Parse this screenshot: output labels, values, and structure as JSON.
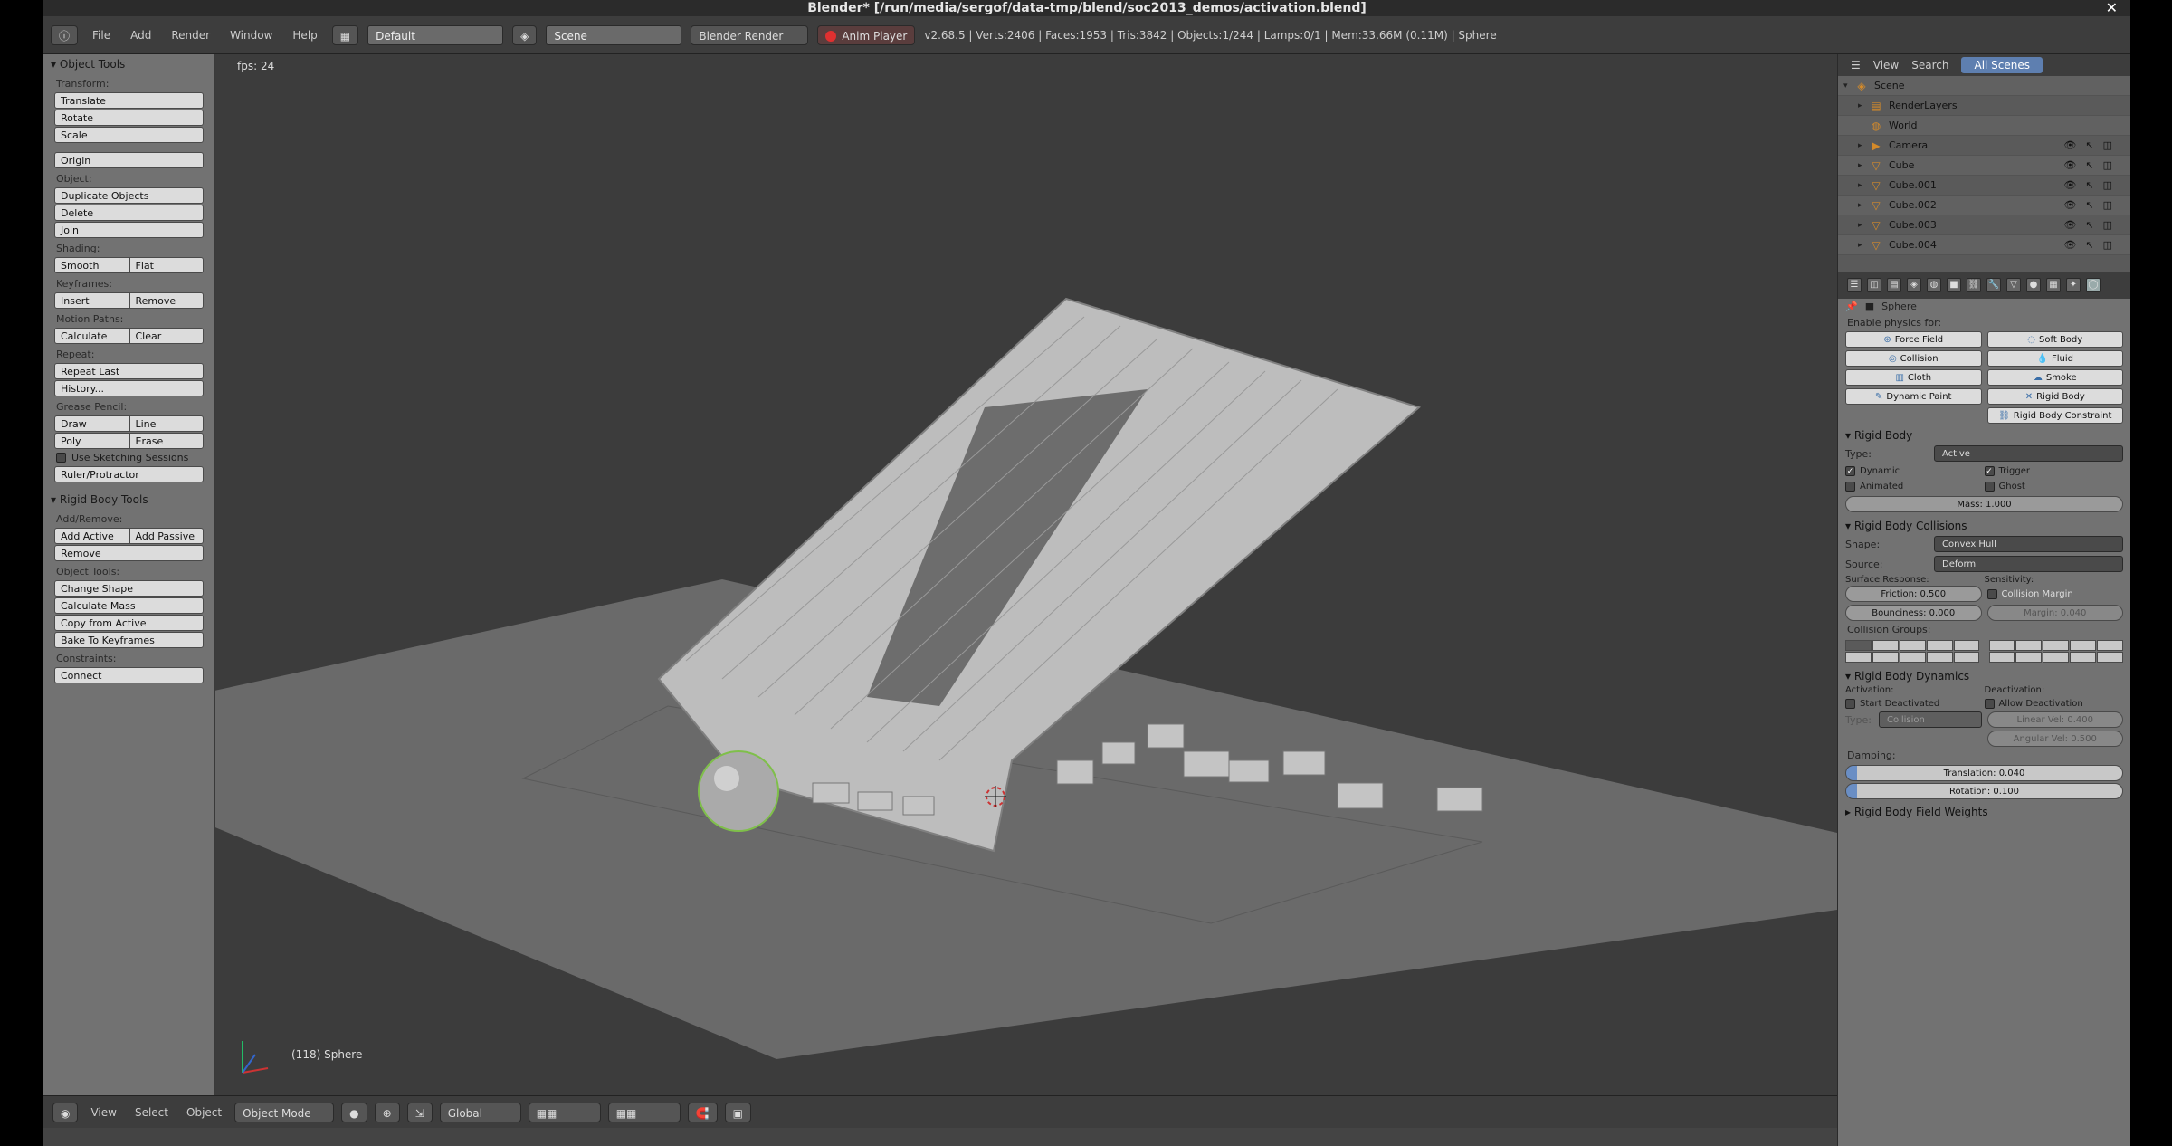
{
  "window": {
    "title": "Blender* [/run/media/sergof/data-tmp/blend/soc2013_demos/activation.blend]"
  },
  "info_header": {
    "menus": [
      "File",
      "Add",
      "Render",
      "Window",
      "Help"
    ],
    "layout": "Default",
    "scene": "Scene",
    "engine": "Blender Render",
    "anim_player": "Anim Player",
    "stats": "v2.68.5 | Verts:2406 | Faces:1953 | Tris:3842 | Objects:1/244 | Lamps:0/1 | Mem:33.66M (0.11M) | Sphere"
  },
  "toolshelf": {
    "title": "Object Tools",
    "transform_label": "Transform:",
    "translate": "Translate",
    "rotate": "Rotate",
    "scale": "Scale",
    "origin": "Origin",
    "object_label": "Object:",
    "duplicate": "Duplicate Objects",
    "delete": "Delete",
    "join": "Join",
    "shading_label": "Shading:",
    "smooth": "Smooth",
    "flat": "Flat",
    "keyframes_label": "Keyframes:",
    "insert": "Insert",
    "remove": "Remove",
    "motion_label": "Motion Paths:",
    "calculate": "Calculate",
    "clear": "Clear",
    "repeat_label": "Repeat:",
    "repeat_last": "Repeat Last",
    "history": "History...",
    "grease_label": "Grease Pencil:",
    "draw": "Draw",
    "line": "Line",
    "poly": "Poly",
    "erase": "Erase",
    "sketch": "Use Sketching Sessions",
    "ruler": "Ruler/Protractor",
    "rb_title": "Rigid Body Tools",
    "addremove_label": "Add/Remove:",
    "add_active": "Add Active",
    "add_passive": "Add Passive",
    "rb_remove": "Remove",
    "objtools_label": "Object Tools:",
    "change_shape": "Change Shape",
    "calc_mass": "Calculate Mass",
    "copy_active": "Copy from Active",
    "bake": "Bake To Keyframes",
    "constraints_label": "Constraints:",
    "connect": "Connect"
  },
  "viewport": {
    "fps": "fps: 24",
    "object": "(118) Sphere"
  },
  "bottom_header": {
    "view": "View",
    "select": "Select",
    "object": "Object",
    "mode": "Object Mode",
    "orientation": "Global"
  },
  "outliner": {
    "tabs": [
      "View",
      "Search",
      "All Scenes"
    ],
    "rows": [
      {
        "name": "Scene",
        "icon": "scene-icon"
      },
      {
        "name": "RenderLayers",
        "icon": "renderlayers-icon"
      },
      {
        "name": "World",
        "icon": "world-icon"
      },
      {
        "name": "Camera",
        "icon": "camera-icon"
      },
      {
        "name": "Cube",
        "icon": "mesh-icon"
      },
      {
        "name": "Cube.001",
        "icon": "mesh-icon"
      },
      {
        "name": "Cube.002",
        "icon": "mesh-icon"
      },
      {
        "name": "Cube.003",
        "icon": "mesh-icon"
      },
      {
        "name": "Cube.004",
        "icon": "mesh-icon"
      }
    ]
  },
  "properties": {
    "context": "Sphere",
    "enable_physics": "Enable physics for:",
    "physics_buttons": [
      "Force Field",
      "Soft Body",
      "Collision",
      "Fluid",
      "Cloth",
      "Smoke",
      "Dynamic Paint",
      "Rigid Body",
      "",
      "Rigid Body Constraint"
    ],
    "rigid_body": "Rigid Body",
    "type_label": "Type:",
    "type_value": "Active",
    "dynamic": "Dynamic",
    "trigger": "Trigger",
    "animated": "Animated",
    "ghost": "Ghost",
    "mass": "Mass: 1.000",
    "collisions": "Rigid Body Collisions",
    "shape_label": "Shape:",
    "shape_value": "Convex Hull",
    "source_label": "Source:",
    "source_value": "Deform",
    "surface_label": "Surface Response:",
    "sensitivity_label": "Sensitivity:",
    "friction": "Friction: 0.500",
    "collision_margin": "Collision Margin",
    "bounciness": "Bounciness: 0.000",
    "margin": "Margin: 0.040",
    "groups_label": "Collision Groups:",
    "dynamics": "Rigid Body Dynamics",
    "activation_label": "Activation:",
    "deactivation_label": "Deactivation:",
    "start_deactivated": "Start Deactivated",
    "allow_deactivation": "Allow Deactivation",
    "type2_label": "Type:",
    "type2_value": "Collision",
    "linear_vel": "Linear Vel: 0.400",
    "angular_vel": "Angular Vel: 0.500",
    "damping_label": "Damping:",
    "translation": "Translation: 0.040",
    "rotation": "Rotation: 0.100",
    "field_weights": "Rigid Body Field Weights"
  }
}
